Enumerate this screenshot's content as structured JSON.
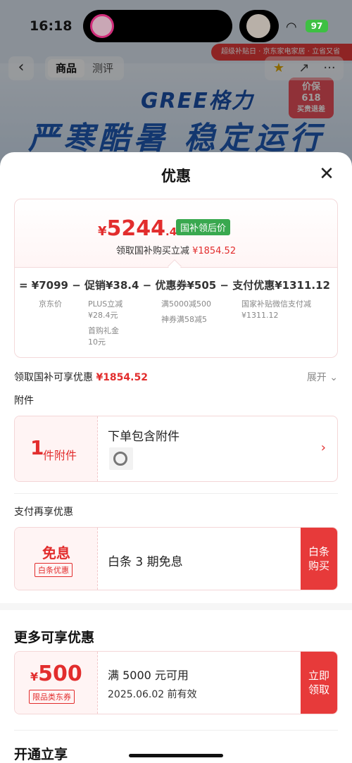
{
  "status": {
    "time": "16:18",
    "battery": "97"
  },
  "background": {
    "tabs": [
      "商品",
      "测评"
    ],
    "brand": "GREE格力",
    "slogan": "严寒酷暑 稳定运行",
    "promo_line1": "价保",
    "promo_line2": "618",
    "promo_line3": "买贵退差",
    "ribbon": "超级补贴日 · 京东家电家居 · 立省又省"
  },
  "sheet": {
    "title": "优惠",
    "price": {
      "symbol": "¥",
      "integer": "5244",
      "decimal": ".48",
      "tag": "国补领后价",
      "sub_label": "领取国补购买立减",
      "sub_amount": "¥1854.52"
    },
    "breakdown": {
      "row": "=  ¥7099  −  促销¥38.4  −  优惠券¥505  −  支付优惠¥1311.12",
      "col1": [
        "京东价"
      ],
      "col2": [
        "PLUS立减",
        "¥28.4元",
        "首购礼金",
        "10元"
      ],
      "col3": [
        "满5000减500",
        "神券满58减5"
      ],
      "col4": [
        "国家补贴微信支付减",
        "¥1311.12"
      ]
    },
    "gov_subsidy": {
      "label": "领取国补可享优惠",
      "amount": "¥1854.52",
      "expand": "展开"
    },
    "accessories": {
      "section": "附件",
      "count": "1",
      "unit": "件附件",
      "title": "下单包含附件",
      "chevron": "›"
    },
    "pay_again": {
      "section": "支付再享优惠",
      "title": "免息",
      "badge": "白条优惠",
      "text": "白条 3 期免息",
      "button": "白条购买"
    },
    "more": {
      "heading": "更多可享优惠",
      "coupon_symbol": "¥",
      "coupon_amount": "500",
      "coupon_badge": "限品类东券",
      "condition": "满 5000 元可用",
      "valid": "2025.06.02 前有效",
      "button": "立即领取"
    },
    "open_share": {
      "heading": "开通立享"
    }
  },
  "colors": {
    "accent": "#e22d2d",
    "green_tag": "#39a84f",
    "card_bg": "#fff4f4"
  }
}
